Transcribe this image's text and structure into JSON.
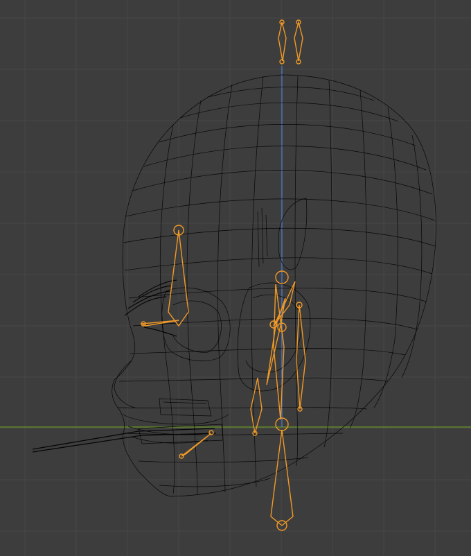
{
  "viewport": {
    "background": "#3d3d3d",
    "grid_color": "#474747",
    "x_axis_color": "#6d9b26",
    "z_axis_color": "#4c7bd0"
  },
  "wireframe": {
    "color": "#000000"
  },
  "armature": {
    "bone_color": "#f29a26"
  }
}
